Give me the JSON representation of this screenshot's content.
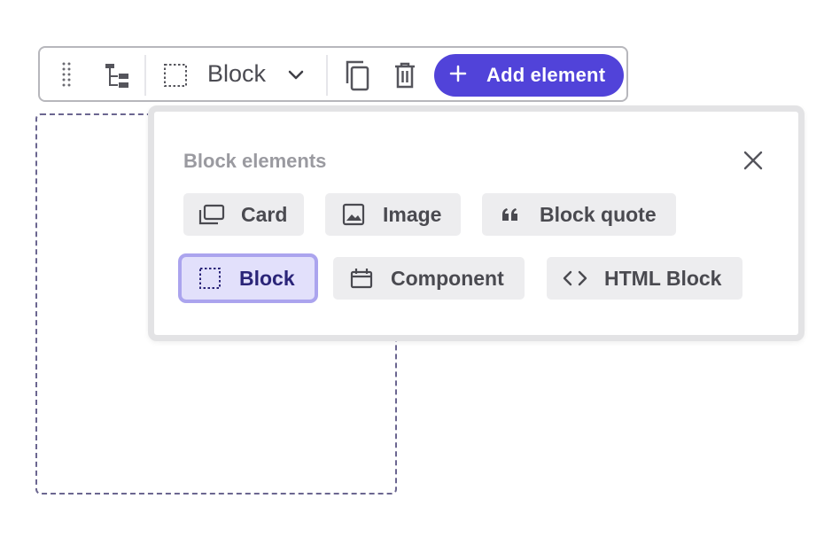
{
  "toolbar": {
    "block_type_label": "Block",
    "add_element_label": "Add element"
  },
  "popover": {
    "title": "Block elements",
    "items": [
      {
        "label": "Card",
        "icon": "cards-icon"
      },
      {
        "label": "Image",
        "icon": "image-icon"
      },
      {
        "label": "Block quote",
        "icon": "quote-icon"
      },
      {
        "label": "Block",
        "icon": "dashed-square-icon",
        "selected": true
      },
      {
        "label": "Component",
        "icon": "component-icon"
      },
      {
        "label": "HTML Block",
        "icon": "code-icon"
      }
    ]
  },
  "colors": {
    "accent": "#5143d9",
    "selected_bg": "#e2e0fb",
    "selected_border": "#aba4ee",
    "chip_bg": "#ededef"
  }
}
